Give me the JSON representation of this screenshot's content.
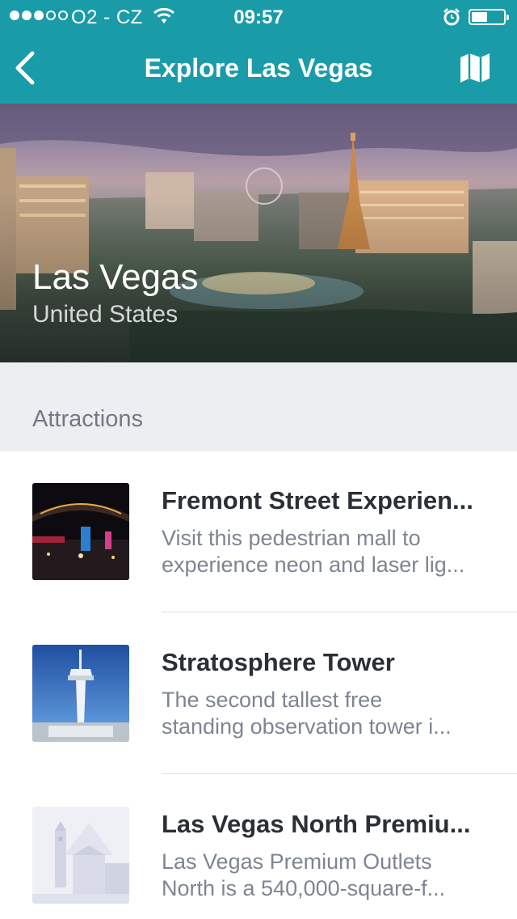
{
  "status_bar": {
    "carrier": "O2 - CZ",
    "time": "09:57",
    "signal_bars": 3,
    "signal_max": 5,
    "battery_level": 0.5
  },
  "nav": {
    "title": "Explore Las Vegas",
    "back_icon": "chevron-left-icon",
    "map_icon": "map-icon"
  },
  "hero": {
    "city": "Las Vegas",
    "country": "United States"
  },
  "section": {
    "label": "Attractions"
  },
  "attractions": [
    {
      "title": "Fremont Street Experien...",
      "desc_line1": "Visit this pedestrian mall to",
      "desc_line2": "experience neon and laser lig..."
    },
    {
      "title": "Stratosphere Tower",
      "desc_line1": "The second tallest free",
      "desc_line2": "standing observation tower i..."
    },
    {
      "title": "Las Vegas North Premiu...",
      "desc_line1": "Las Vegas Premium Outlets",
      "desc_line2": "North is a 540,000-square-f..."
    }
  ],
  "colors": {
    "accent": "#1a9ba8",
    "section_bg": "#eceef2",
    "title_text": "#2b2f36",
    "secondary_text": "#7e8592"
  }
}
